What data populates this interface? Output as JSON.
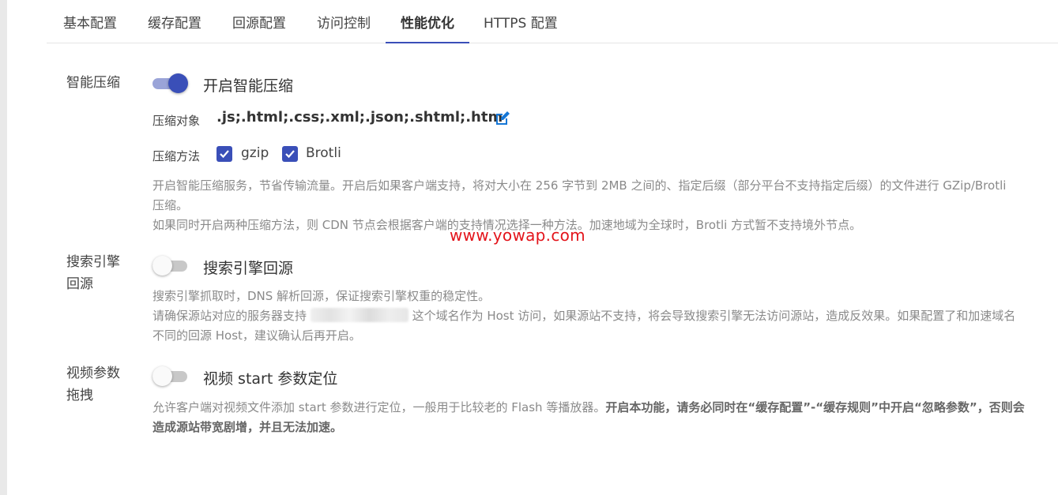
{
  "tabs": [
    {
      "label": "基本配置",
      "active": false
    },
    {
      "label": "缓存配置",
      "active": false
    },
    {
      "label": "回源配置",
      "active": false
    },
    {
      "label": "访问控制",
      "active": false
    },
    {
      "label": "性能优化",
      "active": true
    },
    {
      "label": "HTTPS 配置",
      "active": false
    }
  ],
  "smart_compression": {
    "section_label": "智能压缩",
    "enabled": true,
    "toggle_label": "开启智能压缩",
    "target_label": "压缩对象",
    "target_value": ".js;.html;.css;.xml;.json;.shtml;.htm",
    "method_label": "压缩方法",
    "methods": [
      {
        "label": "gzip",
        "checked": true
      },
      {
        "label": "Brotli",
        "checked": true
      }
    ],
    "desc_line1": "开启智能压缩服务，节省传输流量。开启后如果客户端支持，将对大小在 256 字节到 2MB 之间的、指定后缀（部分平台不支持指定后缀）的文件进行 GZip/Brotli",
    "desc_line2": "压缩。",
    "desc_line3": "如果同时开启两种压缩方法，则 CDN 节点会根据客户端的支持情况选择一种方法。加速地域为全球时，Brotli 方式暂不支持境外节点。"
  },
  "search_engine": {
    "section_label_1": "搜索引擎",
    "section_label_2": "回源",
    "enabled": false,
    "toggle_label": "搜索引擎回源",
    "desc_line1": "搜索引擎抓取时，DNS 解析回源，保证搜索引擎权重的稳定性。",
    "desc_line2_a": "请确保源站对应的服务器支持",
    "desc_line2_b": "这个域名作为 Host 访问，如果源站不支持，将会导致搜索引擎无法访问源站，造成反效果。如果配置了和加速域名",
    "desc_line3": "不同的回源 Host，建议确认后再开启。"
  },
  "video_drag": {
    "section_label_1": "视频参数",
    "section_label_2": "拖拽",
    "enabled": false,
    "toggle_label": "视频 start 参数定位",
    "desc_line1_normal": "允许客户端对视频文件添加 start 参数进行定位，一般用于比较老的 Flash 等播放器。",
    "desc_line1_bold": "开启本功能，请务必同时在“缓存配置”-“缓存规则”中开启“忽略参数”，否则会",
    "desc_line2_bold": "造成源站带宽剧增，并且无法加速。"
  },
  "watermark": "www.yowap.com",
  "colors": {
    "accent": "#3a4fb8",
    "watermark": "#e3141b"
  }
}
